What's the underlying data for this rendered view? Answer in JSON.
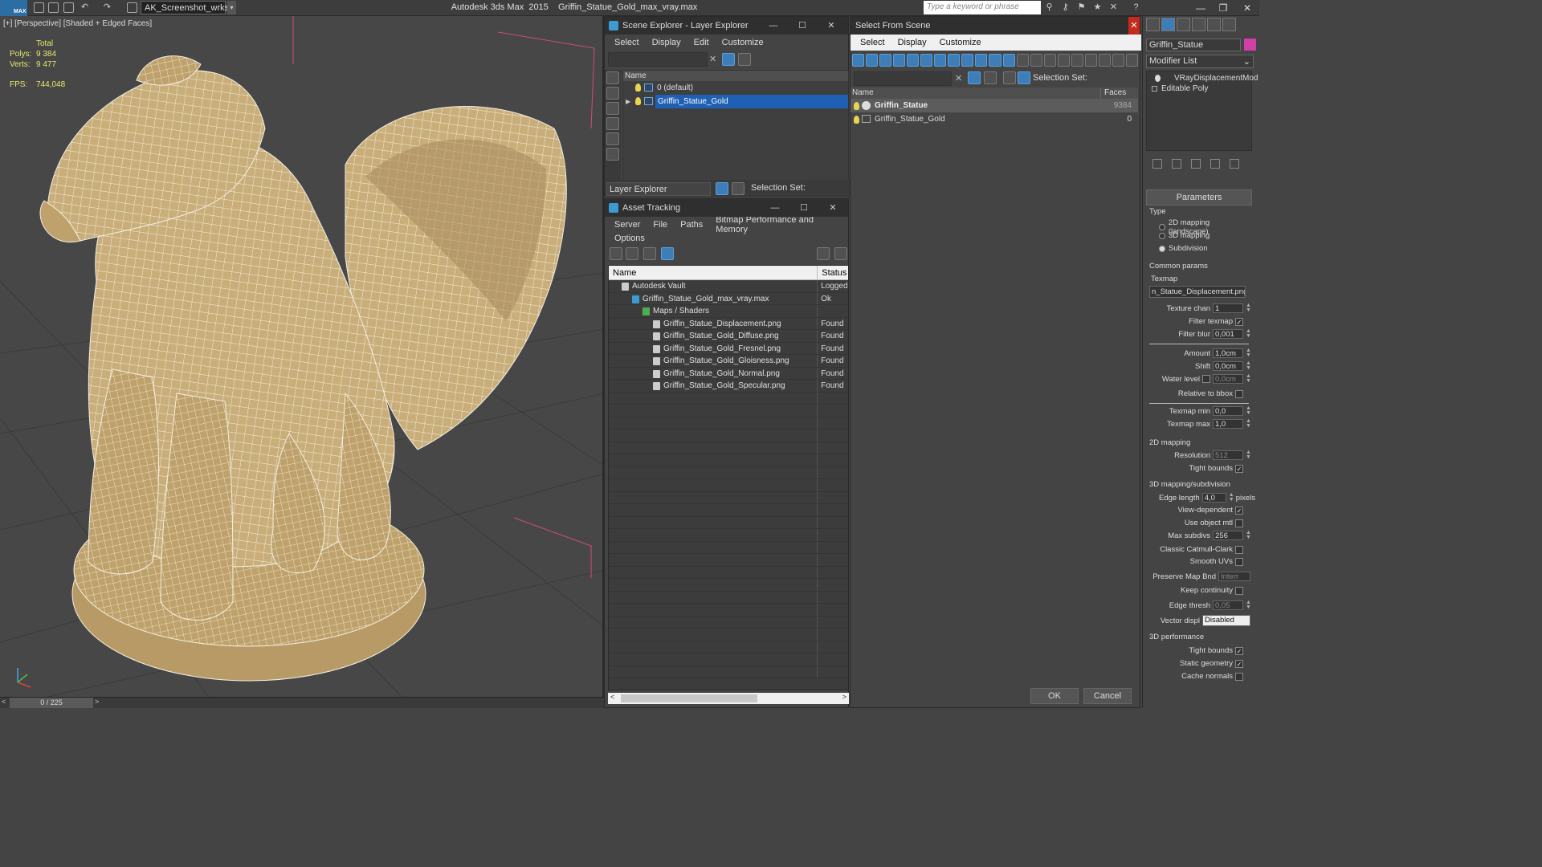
{
  "titlebar": {
    "logo_text": "MAX",
    "workspace": "AK_Screenshot_wrksp",
    "app_name": "Autodesk 3ds Max  2015",
    "file_name": "Griffin_Statue_Gold_max_vray.max",
    "search_placeholder": "Type a keyword or phrase"
  },
  "viewport": {
    "label": "[+] [Perspective] [Shaded + Edged Faces]",
    "stats": {
      "total_label": "Total",
      "polys_label": "Polys:",
      "polys": "9 384",
      "verts_label": "Verts:",
      "verts": "9 477",
      "fps_label": "FPS:",
      "fps": "744,048"
    },
    "timeslider": "0 / 225",
    "model_color": "#c9ae7a",
    "wire_color": "#ffffff"
  },
  "scene_explorer": {
    "title": "Scene Explorer - Layer Explorer",
    "menu": [
      "Select",
      "Display",
      "Edit",
      "Customize"
    ],
    "col_name": "Name",
    "rows": [
      {
        "label": "0 (default)"
      },
      {
        "label": "Griffin_Statue_Gold"
      }
    ],
    "bottom_dropdown": "Layer Explorer",
    "selection_set_label": "Selection Set:"
  },
  "asset_tracking": {
    "title": "Asset Tracking",
    "menu": [
      "Server",
      "File",
      "Paths",
      "Bitmap Performance and Memory",
      "Options"
    ],
    "col_name": "Name",
    "col_status": "Status",
    "rows": [
      {
        "name": "Autodesk Vault",
        "status": "Logged",
        "indent": 1
      },
      {
        "name": "Griffin_Statue_Gold_max_vray.max",
        "status": "Ok",
        "indent": 2
      },
      {
        "name": "Maps / Shaders",
        "status": "",
        "indent": 3
      },
      {
        "name": "Griffin_Statue_Displacement.png",
        "status": "Found",
        "indent": 4
      },
      {
        "name": "Griffin_Statue_Gold_Diffuse.png",
        "status": "Found",
        "indent": 4
      },
      {
        "name": "Griffin_Statue_Gold_Fresnel.png",
        "status": "Found",
        "indent": 4
      },
      {
        "name": "Griffin_Statue_Gold_Gloisness.png",
        "status": "Found",
        "indent": 4
      },
      {
        "name": "Griffin_Statue_Gold_Normal.png",
        "status": "Found",
        "indent": 4
      },
      {
        "name": "Griffin_Statue_Gold_Specular.png",
        "status": "Found",
        "indent": 4
      }
    ]
  },
  "select_from_scene": {
    "title": "Select From Scene",
    "menu": [
      "Select",
      "Display",
      "Customize"
    ],
    "selection_set_label": "Selection Set:",
    "col_name": "Name",
    "col_faces": "Faces",
    "rows": [
      {
        "name": "Griffin_Statue",
        "faces": "9384"
      },
      {
        "name": "Griffin_Statue_Gold",
        "faces": "0"
      }
    ],
    "ok": "OK",
    "cancel": "Cancel"
  },
  "command_panel": {
    "object_name": "Griffin_Statue",
    "object_color": "#d23fa6",
    "modifier_list": "Modifier List",
    "stack": [
      "VRayDisplacementMod",
      "Editable Poly"
    ],
    "rollout": "Parameters",
    "type_label": "Type",
    "type_options": [
      "2D mapping (landscape)",
      "3D mapping",
      "Subdivision"
    ],
    "type_selected": 2,
    "common_params": "Common params",
    "texmap_label": "Texmap",
    "texmap_value": "n_Statue_Displacement.png)",
    "texture_chan_label": "Texture chan",
    "texture_chan": "1",
    "filter_texmap_label": "Filter texmap",
    "filter_blur_label": "Filter blur",
    "filter_blur": "0,001",
    "amount_label": "Amount",
    "amount": "1,0cm",
    "shift_label": "Shift",
    "shift": "0,0cm",
    "water_level_label": "Water level",
    "water_level": "0,0cm",
    "relative_bbox_label": "Relative to bbox",
    "texmap_min_label": "Texmap min",
    "texmap_min": "0,0",
    "texmap_max_label": "Texmap max",
    "texmap_max": "1,0",
    "mapping2d": "2D mapping",
    "resolution_label": "Resolution",
    "resolution": "512",
    "tight_bounds_label": "Tight bounds",
    "mapping3d": "3D mapping/subdivision",
    "edge_length_label": "Edge length",
    "edge_length": "4,0",
    "pixels_label": "pixels",
    "view_dependent_label": "View-dependent",
    "use_object_mtl_label": "Use object mtl",
    "max_subdivs_label": "Max subdivs",
    "max_subdivs": "256",
    "catmull_label": "Classic Catmull-Clark",
    "smooth_uvs_label": "Smooth UVs",
    "preserve_label": "Preserve Map Bnd",
    "preserve_value": "Interr",
    "keep_continuity_label": "Keep continuity",
    "edge_thresh_label": "Edge thresh",
    "edge_thresh": "0,05",
    "vector_displ_label": "Vector displ",
    "vector_displ": "Disabled",
    "perf3d": "3D performance",
    "tight_bounds2_label": "Tight bounds",
    "static_geometry_label": "Static geometry",
    "cache_normals_label": "Cache normals",
    "check_mark": "✓"
  }
}
